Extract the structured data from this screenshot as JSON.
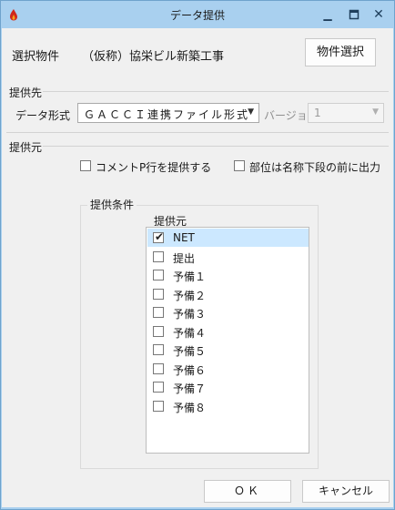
{
  "window": {
    "title": "データ提供"
  },
  "header": {
    "property_label": "選択物件",
    "property_name": "（仮称）協栄ビル新築工事",
    "select_button": "物件選択"
  },
  "dest": {
    "group_label": "提供先",
    "format_label": "データ形式",
    "format_value": "ＧＡＣＣＩ連携ファイル形式",
    "version_label": "バージョン",
    "version_value": "1"
  },
  "source": {
    "group_label": "提供元",
    "option_comment": "コメントP行を提供する",
    "option_part": "部位は名称下段の前に出力",
    "conditions_label": "提供条件",
    "list_label": "提供元",
    "items": [
      {
        "label": "NET",
        "checked": true
      },
      {
        "label": "提出",
        "checked": false
      },
      {
        "label": "予備１",
        "checked": false
      },
      {
        "label": "予備２",
        "checked": false
      },
      {
        "label": "予備３",
        "checked": false
      },
      {
        "label": "予備４",
        "checked": false
      },
      {
        "label": "予備５",
        "checked": false
      },
      {
        "label": "予備６",
        "checked": false
      },
      {
        "label": "予備７",
        "checked": false
      },
      {
        "label": "予備８",
        "checked": false
      }
    ]
  },
  "footer": {
    "ok_label": "ＯＫ",
    "cancel_label": "キャンセル"
  }
}
